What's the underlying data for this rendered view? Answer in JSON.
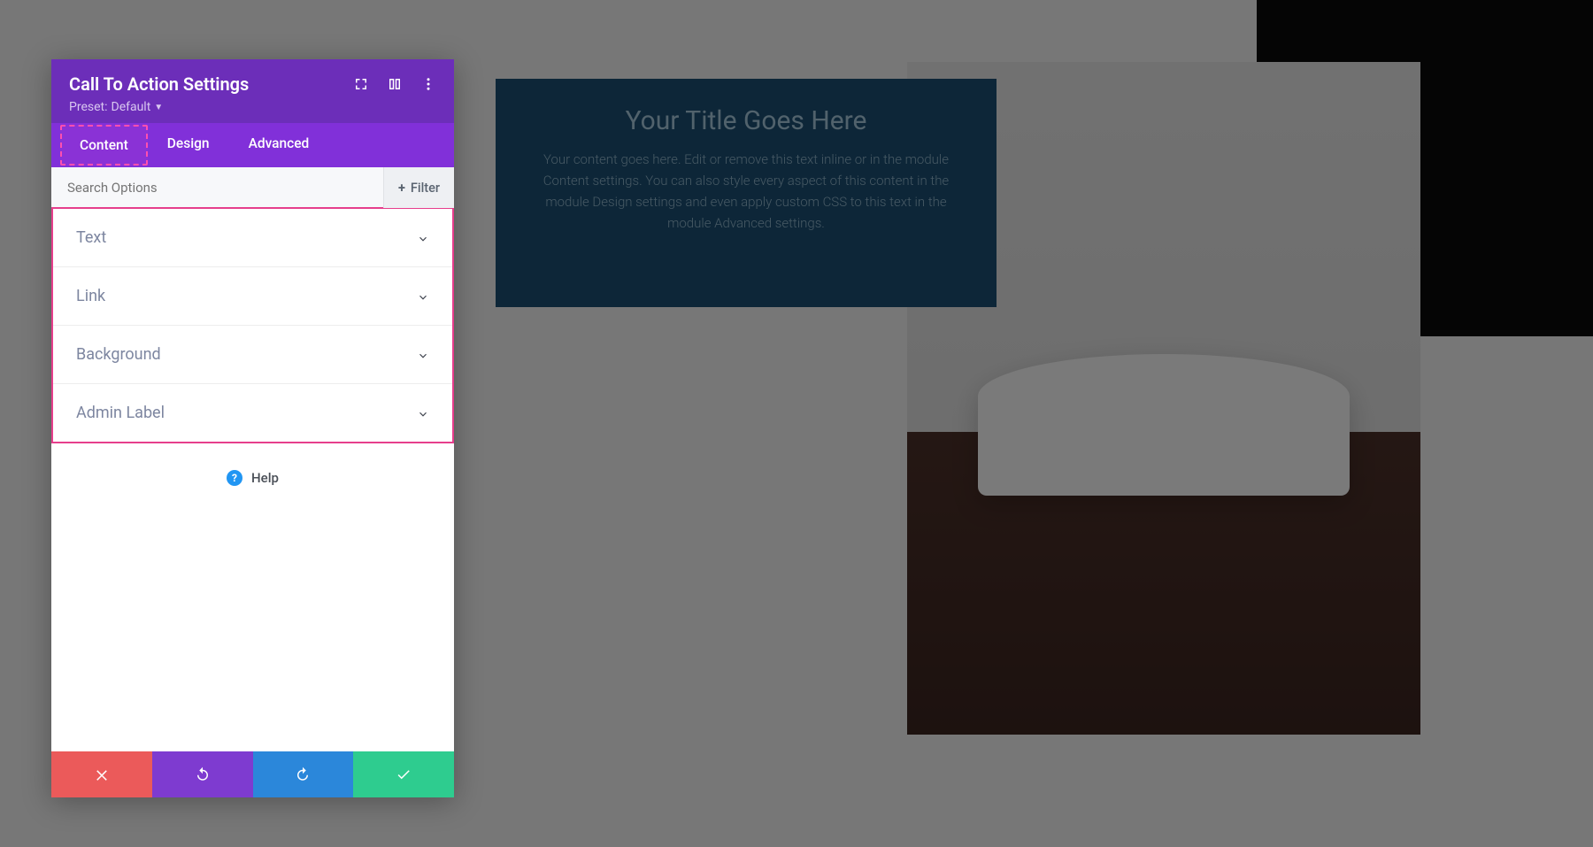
{
  "module": {
    "title": "Your Title Goes Here",
    "body": "Your content goes here. Edit or remove this text inline or in the module Content settings. You can also style every aspect of this content in the module Design settings and even apply custom CSS to this text in the module Advanced settings."
  },
  "panel": {
    "title": "Call To Action Settings",
    "preset_label": "Preset:",
    "preset_value": "Default",
    "tabs": [
      "Content",
      "Design",
      "Advanced"
    ],
    "search_placeholder": "Search Options",
    "filter_label": "Filter",
    "options": [
      {
        "label": "Text"
      },
      {
        "label": "Link"
      },
      {
        "label": "Background"
      },
      {
        "label": "Admin Label"
      }
    ],
    "help_label": "Help"
  },
  "colors": {
    "header": "#6c2eb9",
    "tabs": "#8130d9",
    "highlight": "#e63e8c",
    "cancel": "#eb5a5a",
    "undo": "#7e3bd0",
    "redo": "#2b87da",
    "save": "#2ecc8f",
    "cta_bg": "#1a4d70"
  }
}
